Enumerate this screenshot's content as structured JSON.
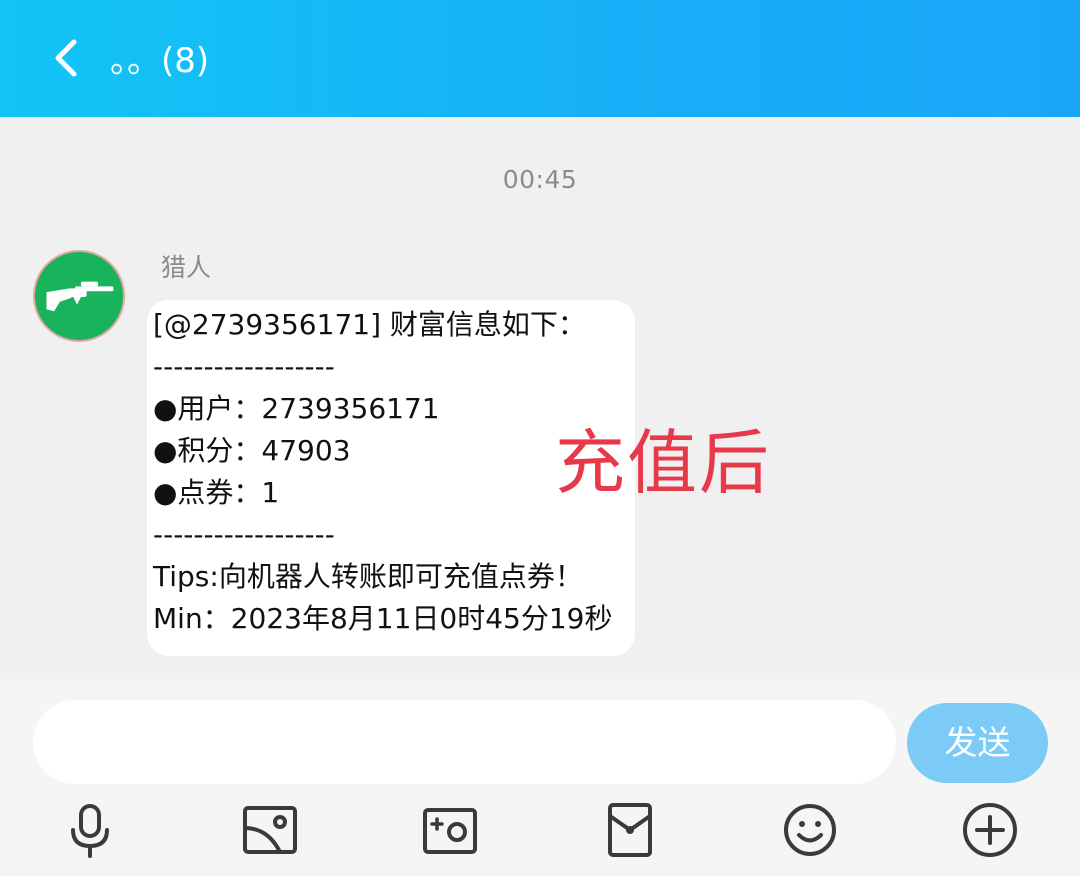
{
  "header": {
    "title": "。。(8)",
    "back_icon": "chevron-left-icon"
  },
  "chat": {
    "timestamp": "00:45",
    "message": {
      "sender": "猎人",
      "avatar_icon": "rifle-icon",
      "lines": [
        "[@2739356171] 财富信息如下：",
        "------------------",
        "●用户：2739356171",
        "●积分：47903",
        "●点券：1",
        "------------------",
        "Tips:向机器人转账即可充值点券！",
        "Min：2023年8月11日0时45分19秒"
      ]
    },
    "annotation": "充值后"
  },
  "input_bar": {
    "placeholder": "",
    "value": "",
    "send_label": "发送"
  },
  "toolbar": {
    "items": [
      {
        "icon": "microphone-icon"
      },
      {
        "icon": "image-icon"
      },
      {
        "icon": "camera-icon"
      },
      {
        "icon": "red-packet-icon"
      },
      {
        "icon": "emoji-icon"
      },
      {
        "icon": "plus-icon"
      }
    ]
  },
  "colors": {
    "header_start": "#12c5f6",
    "header_end": "#1aa6f8",
    "send_button": "#7ccbf7",
    "annotation": "#e8394b",
    "avatar_bg": "#19b35c"
  }
}
